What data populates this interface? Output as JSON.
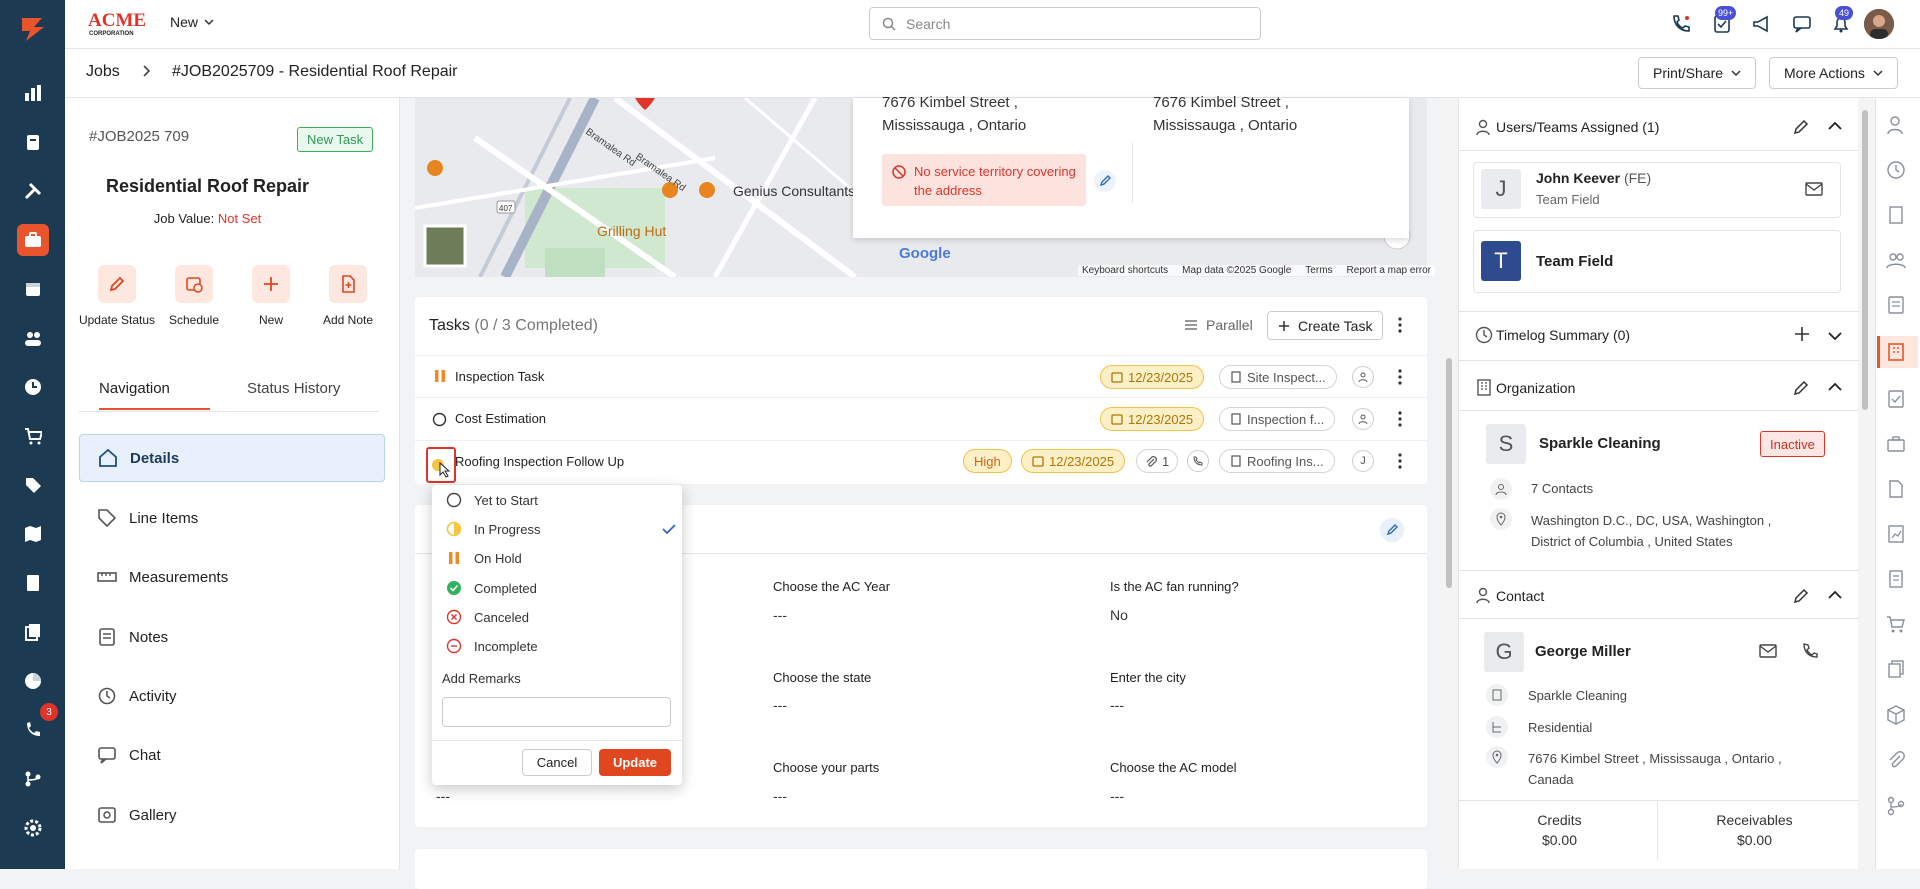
{
  "app": {
    "logo_text": "ACME CORPORATION",
    "new_label": "New",
    "search_placeholder": "Search"
  },
  "top_icons": [
    {
      "name": "phone-icon",
      "badge": ""
    },
    {
      "name": "tasks-icon",
      "badge": "99+"
    },
    {
      "name": "megaphone-icon",
      "badge": ""
    },
    {
      "name": "chat-icon",
      "badge": ""
    },
    {
      "name": "bell-icon",
      "badge": "49"
    }
  ],
  "breadcrumb": {
    "jobs": "Jobs",
    "title": "#JOB2025709 - Residential Roof Repair"
  },
  "header_actions": {
    "print": "Print/Share",
    "more": "More Actions"
  },
  "rail": {
    "badge": "3"
  },
  "job": {
    "id": "#JOB2025 709",
    "badge": "New Task",
    "title": "Residential Roof Repair",
    "value_label": "Job Value:",
    "value": "Not Set"
  },
  "quick_actions": [
    "Update Status",
    "Schedule",
    "New",
    "Add Note"
  ],
  "tabs": {
    "navigation": "Navigation",
    "status_history": "Status History"
  },
  "nav_items": [
    "Details",
    "Line Items",
    "Measurements",
    "Notes",
    "Activity",
    "Chat",
    "Gallery"
  ],
  "map": {
    "labels": [
      "Genius Consultants",
      "Grilling Hut",
      "Bramalea Rd",
      "Bramalea Rd",
      "407",
      "Google"
    ],
    "footer": [
      "Keyboard shortcuts",
      "Map data ©2025 Google",
      "Terms",
      "Report a map error"
    ]
  },
  "address": {
    "line1": "7676 Kimbel Street ,",
    "line2": "Mississauga , Ontario",
    "line1b": "7676 Kimbel Street ,",
    "line2b": "Mississauga , Ontario",
    "warning": "No service territory covering the address"
  },
  "tasks": {
    "title": "Tasks",
    "count": "(0 / 3 Completed)",
    "mode": "Parallel",
    "create": "Create Task",
    "rows": [
      {
        "name": "Inspection Task",
        "date": "12/23/2025",
        "form": "Site Inspect..."
      },
      {
        "name": "Cost Estimation",
        "date": "12/23/2025",
        "form": "Inspection f..."
      },
      {
        "name": "Roofing Inspection Follow Up",
        "priority": "High",
        "date": "12/23/2025",
        "attachments": "1",
        "form": "Roofing Ins...",
        "assignee": "J"
      }
    ]
  },
  "status_menu": {
    "options": [
      "Yet to Start",
      "In Progress",
      "On Hold",
      "Completed",
      "Canceled",
      "Incomplete"
    ],
    "selected": "In Progress",
    "remarks_label": "Add Remarks",
    "cancel": "Cancel",
    "update": "Update"
  },
  "form": {
    "fields": [
      {
        "label": "Choose the AC Year",
        "value": "---"
      },
      {
        "label": "Is the AC fan running?",
        "value": "No"
      },
      {
        "label": "Choose the state",
        "value": "---"
      },
      {
        "label": "Enter the city",
        "value": "---"
      },
      {
        "label": "Choose your parts",
        "value": "---"
      },
      {
        "label": "Choose the AC model",
        "value": "---"
      }
    ],
    "hidden_values": [
      "---"
    ]
  },
  "right": {
    "users_title": "Users/Teams Assigned (1)",
    "user_name": "John Keever",
    "user_suffix": "(FE)",
    "user_team": "Team Field",
    "team_name": "Team Field",
    "timelog_title": "Timelog Summary (0)",
    "org_title": "Organization",
    "org_name": "Sparkle Cleaning",
    "org_status": "Inactive",
    "org_contacts": "7 Contacts",
    "org_addr1": "Washington D.C., DC, USA, Washington ,",
    "org_addr2": "District of Columbia , United States",
    "contact_title": "Contact",
    "contact_name": "George Miller",
    "contact_company": "Sparkle Cleaning",
    "contact_type": "Residential",
    "contact_addr1": "7676 Kimbel Street , Mississauga , Ontario ,",
    "contact_addr2": "Canada",
    "credits_label": "Credits",
    "credits_value": "$0.00",
    "receivables_label": "Receivables",
    "receivables_value": "$0.00"
  },
  "colors": {
    "accent": "#e8542b",
    "rail": "#1c3a52",
    "date_pill": "#fdf0c7"
  }
}
